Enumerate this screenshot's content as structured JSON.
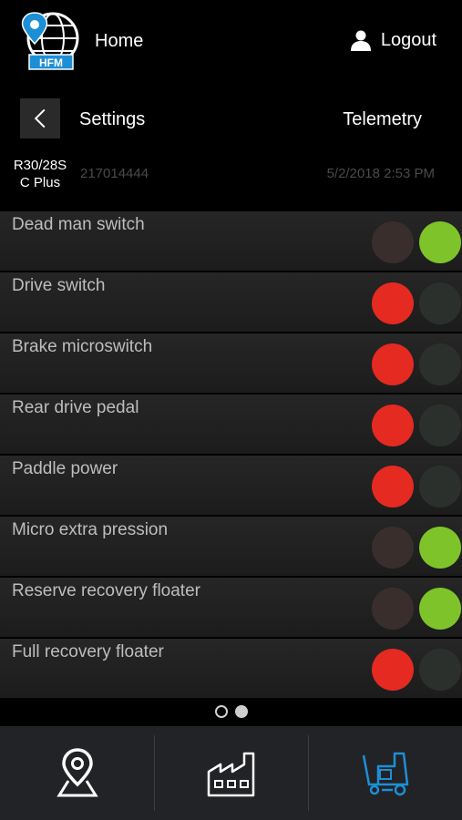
{
  "header": {
    "logo_text": "HFM",
    "home_label": "Home",
    "logout_label": "Logout"
  },
  "nav": {
    "settings_label": "Settings",
    "telemetry_label": "Telemetry"
  },
  "machine": {
    "model_line1": "R30/28S",
    "model_line2": "C Plus",
    "serial": "217014444",
    "timestamp": "5/2/2018 2:53 PM"
  },
  "switches": [
    {
      "label": "Dead man switch",
      "red_on": false,
      "green_on": true
    },
    {
      "label": "Drive switch",
      "red_on": true,
      "green_on": false
    },
    {
      "label": "Brake microswitch",
      "red_on": true,
      "green_on": false
    },
    {
      "label": "Rear drive pedal",
      "red_on": true,
      "green_on": false
    },
    {
      "label": "Paddle power",
      "red_on": true,
      "green_on": false
    },
    {
      "label": "Micro extra pression",
      "red_on": false,
      "green_on": true
    },
    {
      "label": "Reserve recovery floater",
      "red_on": false,
      "green_on": true
    },
    {
      "label": "Full recovery floater",
      "red_on": true,
      "green_on": false
    }
  ],
  "pager": {
    "pages": 2,
    "current": 2
  },
  "tabs": [
    {
      "icon": "map-pin-icon",
      "active": false
    },
    {
      "icon": "factory-icon",
      "active": false
    },
    {
      "icon": "scrubber-machine-icon",
      "active": true
    }
  ],
  "colors": {
    "red_on": "#e52a22",
    "green_on": "#7fc32a",
    "active_tab": "#1d8fd6",
    "inactive_tab": "#ffffff"
  }
}
